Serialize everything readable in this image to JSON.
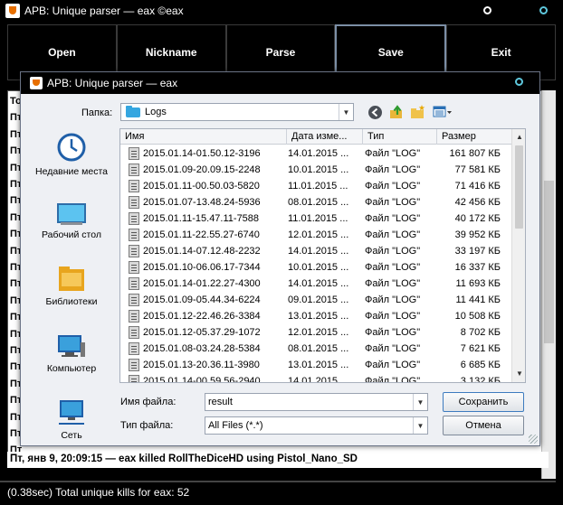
{
  "main": {
    "title": "APB: Unique parser — eax ©eax",
    "menu": [
      "Open",
      "Nickname",
      "Parse",
      "Save",
      "Exit"
    ],
    "log_lines": [
      "То",
      "Пт",
      "Пт",
      "Пт",
      "Пт",
      "Пт",
      "Пт",
      "Пт",
      "Пт",
      "Пт",
      "Пт",
      "Пт",
      "Пт",
      "Пт",
      "Пт",
      "Пт",
      "Пт",
      "Пт",
      "Пт",
      "Пт",
      "Пт",
      "Пт",
      "Пт"
    ],
    "last_line": "Пт, янв 9, 20:09:15 — eax killed RollTheDiceHD using Pistol_Nano_SD",
    "status": "(0.38sec) Total unique kills for eax: 52"
  },
  "dialog": {
    "title": "APB: Unique parser — eax",
    "folder_label": "Папка:",
    "folder_value": "Logs",
    "places": [
      {
        "label": "Недавние места",
        "icon": "recent-places-icon"
      },
      {
        "label": "Рабочий стол",
        "icon": "desktop-icon"
      },
      {
        "label": "Библиотеки",
        "icon": "libraries-icon"
      },
      {
        "label": "Компьютер",
        "icon": "computer-icon"
      },
      {
        "label": "Сеть",
        "icon": "network-icon"
      }
    ],
    "columns": {
      "name": "Имя",
      "date": "Дата изме...",
      "type": "Тип",
      "size": "Размер"
    },
    "files": [
      {
        "name": "2015.01.14-01.50.12-3196",
        "date": "14.01.2015 ...",
        "type": "Файл \"LOG\"",
        "size": "161 807 КБ"
      },
      {
        "name": "2015.01.09-20.09.15-2248",
        "date": "10.01.2015 ...",
        "type": "Файл \"LOG\"",
        "size": "77 581 КБ"
      },
      {
        "name": "2015.01.11-00.50.03-5820",
        "date": "11.01.2015 ...",
        "type": "Файл \"LOG\"",
        "size": "71 416 КБ"
      },
      {
        "name": "2015.01.07-13.48.24-5936",
        "date": "08.01.2015 ...",
        "type": "Файл \"LOG\"",
        "size": "42 456 КБ"
      },
      {
        "name": "2015.01.11-15.47.11-7588",
        "date": "11.01.2015 ...",
        "type": "Файл \"LOG\"",
        "size": "40 172 КБ"
      },
      {
        "name": "2015.01.11-22.55.27-6740",
        "date": "12.01.2015 ...",
        "type": "Файл \"LOG\"",
        "size": "39 952 КБ"
      },
      {
        "name": "2015.01.14-07.12.48-2232",
        "date": "14.01.2015 ...",
        "type": "Файл \"LOG\"",
        "size": "33 197 КБ"
      },
      {
        "name": "2015.01.10-06.06.17-7344",
        "date": "10.01.2015 ...",
        "type": "Файл \"LOG\"",
        "size": "16 337 КБ"
      },
      {
        "name": "2015.01.14-01.22.27-4300",
        "date": "14.01.2015 ...",
        "type": "Файл \"LOG\"",
        "size": "11 693 КБ"
      },
      {
        "name": "2015.01.09-05.44.34-6224",
        "date": "09.01.2015 ...",
        "type": "Файл \"LOG\"",
        "size": "11 441 КБ"
      },
      {
        "name": "2015.01.12-22.46.26-3384",
        "date": "13.01.2015 ...",
        "type": "Файл \"LOG\"",
        "size": "10 508 КБ"
      },
      {
        "name": "2015.01.12-05.37.29-1072",
        "date": "12.01.2015 ...",
        "type": "Файл \"LOG\"",
        "size": "8 702 КБ"
      },
      {
        "name": "2015.01.08-03.24.28-5384",
        "date": "08.01.2015 ...",
        "type": "Файл \"LOG\"",
        "size": "7 621 КБ"
      },
      {
        "name": "2015.01.13-20.36.11-3980",
        "date": "13.01.2015 ...",
        "type": "Файл \"LOG\"",
        "size": "6 685 КБ"
      },
      {
        "name": "2015.01.14-00.59.56-2940",
        "date": "14.01.2015 ...",
        "type": "Файл \"LOG\"",
        "size": "3 132 КБ"
      }
    ],
    "filename_label": "Имя файла:",
    "filename_value": "result",
    "filetype_label": "Тип файла:",
    "filetype_value": "All Files (*.*)",
    "save_label": "Сохранить",
    "cancel_label": "Отмена"
  }
}
